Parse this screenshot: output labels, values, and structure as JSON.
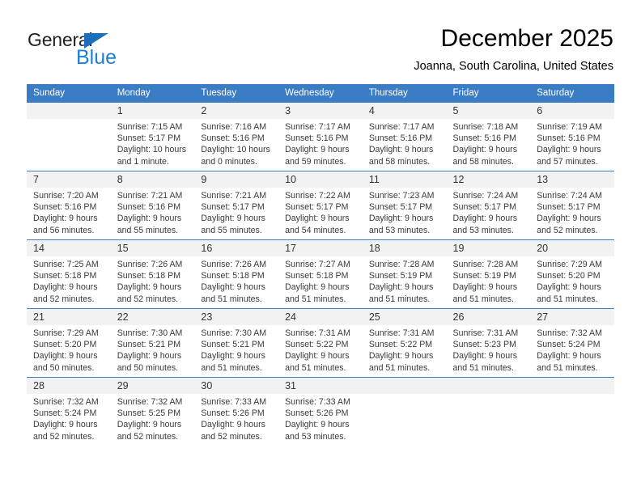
{
  "branding": {
    "name_part1": "General",
    "name_part2": "Blue",
    "colors": {
      "brand_blue": "#1c7fd6",
      "header_blue": "#3b7dc4",
      "band_gray": "#f2f2f2"
    }
  },
  "header": {
    "title": "December 2025",
    "subtitle": "Joanna, South Carolina, United States"
  },
  "calendar": {
    "weekday_headers": [
      "Sunday",
      "Monday",
      "Tuesday",
      "Wednesday",
      "Thursday",
      "Friday",
      "Saturday"
    ],
    "weeks": [
      [
        {
          "day": "",
          "sunrise": "",
          "sunset": "",
          "daylight_line1": "",
          "daylight_line2": ""
        },
        {
          "day": "1",
          "sunrise": "Sunrise: 7:15 AM",
          "sunset": "Sunset: 5:17 PM",
          "daylight_line1": "Daylight: 10 hours",
          "daylight_line2": "and 1 minute."
        },
        {
          "day": "2",
          "sunrise": "Sunrise: 7:16 AM",
          "sunset": "Sunset: 5:16 PM",
          "daylight_line1": "Daylight: 10 hours",
          "daylight_line2": "and 0 minutes."
        },
        {
          "day": "3",
          "sunrise": "Sunrise: 7:17 AM",
          "sunset": "Sunset: 5:16 PM",
          "daylight_line1": "Daylight: 9 hours",
          "daylight_line2": "and 59 minutes."
        },
        {
          "day": "4",
          "sunrise": "Sunrise: 7:17 AM",
          "sunset": "Sunset: 5:16 PM",
          "daylight_line1": "Daylight: 9 hours",
          "daylight_line2": "and 58 minutes."
        },
        {
          "day": "5",
          "sunrise": "Sunrise: 7:18 AM",
          "sunset": "Sunset: 5:16 PM",
          "daylight_line1": "Daylight: 9 hours",
          "daylight_line2": "and 58 minutes."
        },
        {
          "day": "6",
          "sunrise": "Sunrise: 7:19 AM",
          "sunset": "Sunset: 5:16 PM",
          "daylight_line1": "Daylight: 9 hours",
          "daylight_line2": "and 57 minutes."
        }
      ],
      [
        {
          "day": "7",
          "sunrise": "Sunrise: 7:20 AM",
          "sunset": "Sunset: 5:16 PM",
          "daylight_line1": "Daylight: 9 hours",
          "daylight_line2": "and 56 minutes."
        },
        {
          "day": "8",
          "sunrise": "Sunrise: 7:21 AM",
          "sunset": "Sunset: 5:16 PM",
          "daylight_line1": "Daylight: 9 hours",
          "daylight_line2": "and 55 minutes."
        },
        {
          "day": "9",
          "sunrise": "Sunrise: 7:21 AM",
          "sunset": "Sunset: 5:17 PM",
          "daylight_line1": "Daylight: 9 hours",
          "daylight_line2": "and 55 minutes."
        },
        {
          "day": "10",
          "sunrise": "Sunrise: 7:22 AM",
          "sunset": "Sunset: 5:17 PM",
          "daylight_line1": "Daylight: 9 hours",
          "daylight_line2": "and 54 minutes."
        },
        {
          "day": "11",
          "sunrise": "Sunrise: 7:23 AM",
          "sunset": "Sunset: 5:17 PM",
          "daylight_line1": "Daylight: 9 hours",
          "daylight_line2": "and 53 minutes."
        },
        {
          "day": "12",
          "sunrise": "Sunrise: 7:24 AM",
          "sunset": "Sunset: 5:17 PM",
          "daylight_line1": "Daylight: 9 hours",
          "daylight_line2": "and 53 minutes."
        },
        {
          "day": "13",
          "sunrise": "Sunrise: 7:24 AM",
          "sunset": "Sunset: 5:17 PM",
          "daylight_line1": "Daylight: 9 hours",
          "daylight_line2": "and 52 minutes."
        }
      ],
      [
        {
          "day": "14",
          "sunrise": "Sunrise: 7:25 AM",
          "sunset": "Sunset: 5:18 PM",
          "daylight_line1": "Daylight: 9 hours",
          "daylight_line2": "and 52 minutes."
        },
        {
          "day": "15",
          "sunrise": "Sunrise: 7:26 AM",
          "sunset": "Sunset: 5:18 PM",
          "daylight_line1": "Daylight: 9 hours",
          "daylight_line2": "and 52 minutes."
        },
        {
          "day": "16",
          "sunrise": "Sunrise: 7:26 AM",
          "sunset": "Sunset: 5:18 PM",
          "daylight_line1": "Daylight: 9 hours",
          "daylight_line2": "and 51 minutes."
        },
        {
          "day": "17",
          "sunrise": "Sunrise: 7:27 AM",
          "sunset": "Sunset: 5:18 PM",
          "daylight_line1": "Daylight: 9 hours",
          "daylight_line2": "and 51 minutes."
        },
        {
          "day": "18",
          "sunrise": "Sunrise: 7:28 AM",
          "sunset": "Sunset: 5:19 PM",
          "daylight_line1": "Daylight: 9 hours",
          "daylight_line2": "and 51 minutes."
        },
        {
          "day": "19",
          "sunrise": "Sunrise: 7:28 AM",
          "sunset": "Sunset: 5:19 PM",
          "daylight_line1": "Daylight: 9 hours",
          "daylight_line2": "and 51 minutes."
        },
        {
          "day": "20",
          "sunrise": "Sunrise: 7:29 AM",
          "sunset": "Sunset: 5:20 PM",
          "daylight_line1": "Daylight: 9 hours",
          "daylight_line2": "and 51 minutes."
        }
      ],
      [
        {
          "day": "21",
          "sunrise": "Sunrise: 7:29 AM",
          "sunset": "Sunset: 5:20 PM",
          "daylight_line1": "Daylight: 9 hours",
          "daylight_line2": "and 50 minutes."
        },
        {
          "day": "22",
          "sunrise": "Sunrise: 7:30 AM",
          "sunset": "Sunset: 5:21 PM",
          "daylight_line1": "Daylight: 9 hours",
          "daylight_line2": "and 50 minutes."
        },
        {
          "day": "23",
          "sunrise": "Sunrise: 7:30 AM",
          "sunset": "Sunset: 5:21 PM",
          "daylight_line1": "Daylight: 9 hours",
          "daylight_line2": "and 51 minutes."
        },
        {
          "day": "24",
          "sunrise": "Sunrise: 7:31 AM",
          "sunset": "Sunset: 5:22 PM",
          "daylight_line1": "Daylight: 9 hours",
          "daylight_line2": "and 51 minutes."
        },
        {
          "day": "25",
          "sunrise": "Sunrise: 7:31 AM",
          "sunset": "Sunset: 5:22 PM",
          "daylight_line1": "Daylight: 9 hours",
          "daylight_line2": "and 51 minutes."
        },
        {
          "day": "26",
          "sunrise": "Sunrise: 7:31 AM",
          "sunset": "Sunset: 5:23 PM",
          "daylight_line1": "Daylight: 9 hours",
          "daylight_line2": "and 51 minutes."
        },
        {
          "day": "27",
          "sunrise": "Sunrise: 7:32 AM",
          "sunset": "Sunset: 5:24 PM",
          "daylight_line1": "Daylight: 9 hours",
          "daylight_line2": "and 51 minutes."
        }
      ],
      [
        {
          "day": "28",
          "sunrise": "Sunrise: 7:32 AM",
          "sunset": "Sunset: 5:24 PM",
          "daylight_line1": "Daylight: 9 hours",
          "daylight_line2": "and 52 minutes."
        },
        {
          "day": "29",
          "sunrise": "Sunrise: 7:32 AM",
          "sunset": "Sunset: 5:25 PM",
          "daylight_line1": "Daylight: 9 hours",
          "daylight_line2": "and 52 minutes."
        },
        {
          "day": "30",
          "sunrise": "Sunrise: 7:33 AM",
          "sunset": "Sunset: 5:26 PM",
          "daylight_line1": "Daylight: 9 hours",
          "daylight_line2": "and 52 minutes."
        },
        {
          "day": "31",
          "sunrise": "Sunrise: 7:33 AM",
          "sunset": "Sunset: 5:26 PM",
          "daylight_line1": "Daylight: 9 hours",
          "daylight_line2": "and 53 minutes."
        },
        {
          "day": "",
          "sunrise": "",
          "sunset": "",
          "daylight_line1": "",
          "daylight_line2": ""
        },
        {
          "day": "",
          "sunrise": "",
          "sunset": "",
          "daylight_line1": "",
          "daylight_line2": ""
        },
        {
          "day": "",
          "sunrise": "",
          "sunset": "",
          "daylight_line1": "",
          "daylight_line2": ""
        }
      ]
    ]
  }
}
